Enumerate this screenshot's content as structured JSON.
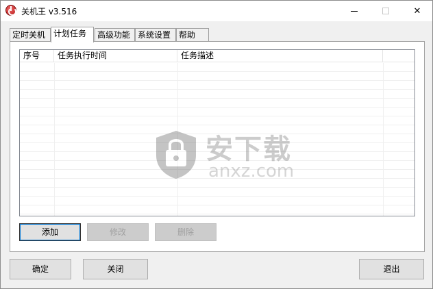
{
  "window": {
    "title": "关机王 v3.516"
  },
  "tabs": [
    {
      "label": "定时关机"
    },
    {
      "label": "计划任务"
    },
    {
      "label": "高级功能"
    },
    {
      "label": "系统设置"
    },
    {
      "label": "帮助"
    }
  ],
  "active_tab": "计划任务",
  "task_list": {
    "columns": [
      "序号",
      "任务执行时间",
      "任务描述",
      ""
    ],
    "rows": []
  },
  "watermark": {
    "text": "安下载",
    "sub": "anxz.com"
  },
  "panel_buttons": {
    "add_label": "添加",
    "edit_label": "修改",
    "delete_label": "删除"
  },
  "footer_buttons": {
    "ok_label": "确定",
    "close_label": "关闭",
    "exit_label": "退出"
  },
  "colors": {
    "focus_accent": "#0078d7",
    "window_bg": "#f0f0f0",
    "panel_bg": "#ffffff"
  }
}
